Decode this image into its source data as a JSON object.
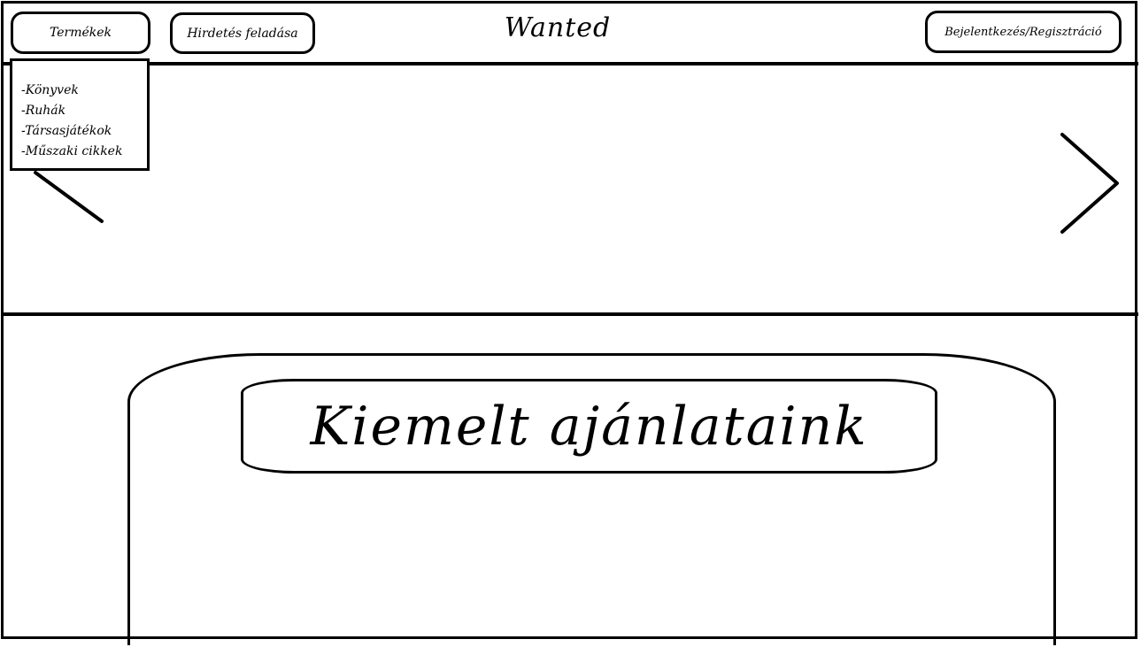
{
  "header": {
    "products_button": "Termékek",
    "post_ad_button": "Hirdetés feladása",
    "site_title": "Wanted",
    "login_button": "Bejelentkezés/Regisztráció"
  },
  "products_menu": {
    "items": [
      {
        "label": "-Könyvek"
      },
      {
        "label": "-Ruhák"
      },
      {
        "label": "-Társasjátékok"
      },
      {
        "label": "-Műszaki cikkek"
      }
    ]
  },
  "carousel": {
    "prev_icon": "chevron-left-icon",
    "next_icon": "chevron-right-icon"
  },
  "featured": {
    "title": "Kiemelt ajánlataink"
  }
}
